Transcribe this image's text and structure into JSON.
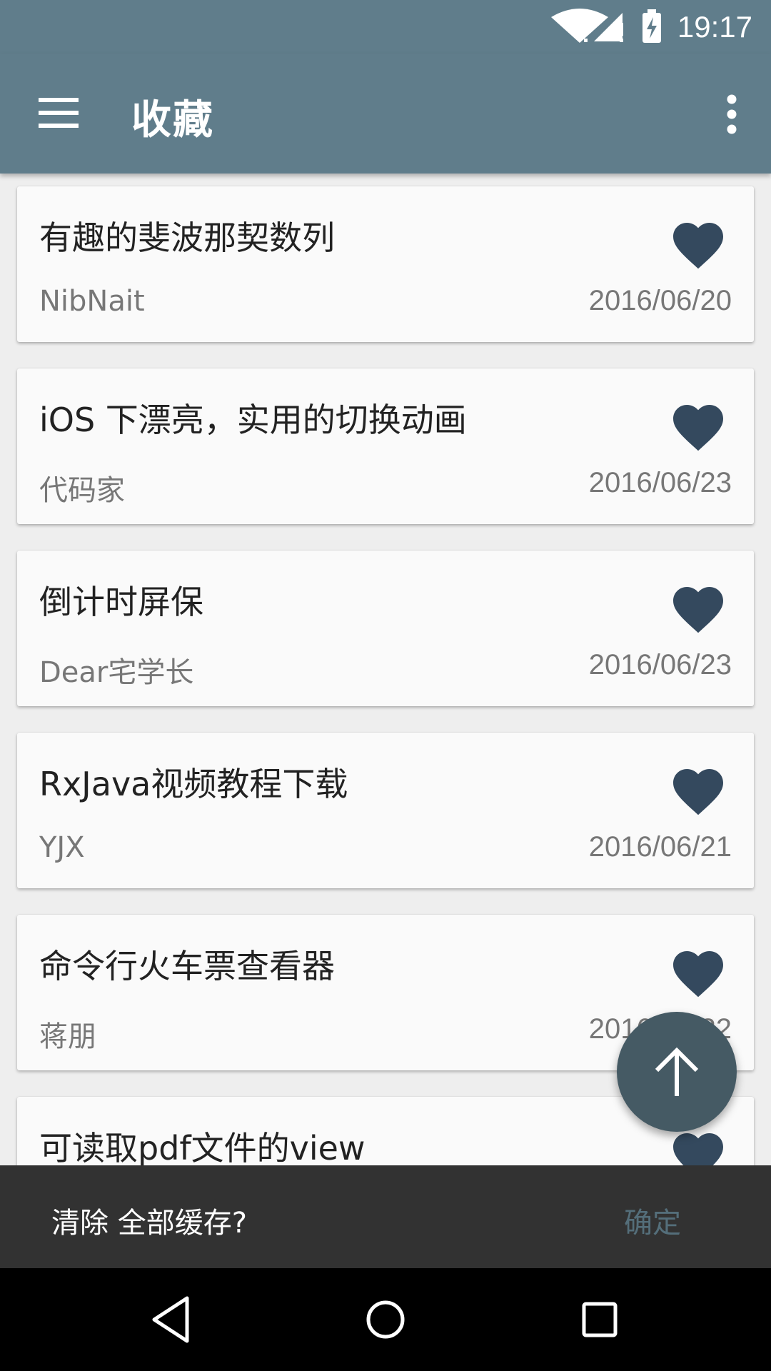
{
  "status_bar": {
    "time": "19:17",
    "icons": [
      "wifi-icon",
      "signal-icon",
      "battery-charging-icon"
    ]
  },
  "app_bar": {
    "title": "收藏",
    "menu_icon": "menu-icon",
    "more_icon": "more-vert-icon",
    "color": "#607d8b"
  },
  "favorites": [
    {
      "title": "有趣的斐波那契数列",
      "author": "NibNait",
      "date": "2016/06/20",
      "favorited": true
    },
    {
      "title": "iOS 下漂亮，实用的切换动画",
      "author": "代码家",
      "date": "2016/06/23",
      "favorited": true
    },
    {
      "title": "倒计时屏保",
      "author": "Dear宅学长",
      "date": "2016/06/23",
      "favorited": true
    },
    {
      "title": "RxJava视频教程下载",
      "author": "YJX",
      "date": "2016/06/21",
      "favorited": true
    },
    {
      "title": "命令行火车票查看器",
      "author": "蒋朋",
      "date": "2016/06/22",
      "favorited": true
    },
    {
      "title": "可读取pdf文件的view",
      "author": "",
      "date": "",
      "favorited": true
    }
  ],
  "fab": {
    "icon": "arrow-up-icon",
    "color": "#455a64"
  },
  "snackbar": {
    "message": "清除 全部缓存?",
    "action": "确定",
    "action_color": "#546e7a"
  },
  "nav_bar": {
    "buttons": [
      "back-icon",
      "home-icon",
      "recents-icon"
    ]
  },
  "colors": {
    "heart": "#34495e",
    "card_bg": "#fafafa"
  }
}
